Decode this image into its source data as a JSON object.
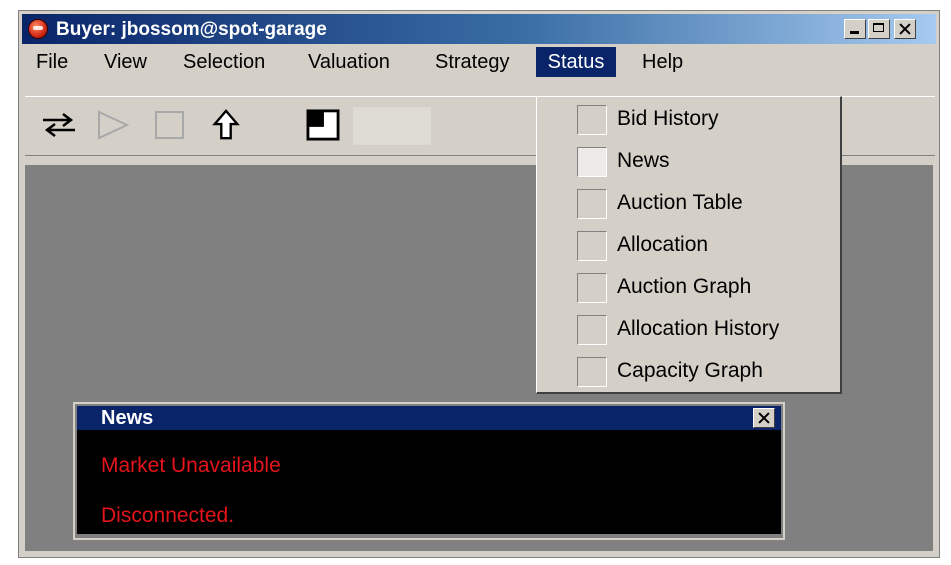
{
  "window": {
    "title": "Buyer: jbossom@spot-garage"
  },
  "menubar": {
    "items": [
      {
        "label": "File"
      },
      {
        "label": "View"
      },
      {
        "label": "Selection"
      },
      {
        "label": "Valuation"
      },
      {
        "label": "Strategy"
      },
      {
        "label": "Status",
        "active": true
      },
      {
        "label": "Help"
      }
    ]
  },
  "toolbar": {
    "icons": [
      "swap-arrows-icon",
      "play-icon",
      "stop-icon",
      "up-arrow-icon",
      "window-layout-icon"
    ]
  },
  "status_menu": {
    "items": [
      {
        "label": "Bid History",
        "checked": false
      },
      {
        "label": "News",
        "checked": true
      },
      {
        "label": "Auction Table",
        "checked": false
      },
      {
        "label": "Allocation",
        "checked": false
      },
      {
        "label": "Auction Graph",
        "checked": false
      },
      {
        "label": "Allocation History",
        "checked": false
      },
      {
        "label": "Capacity Graph",
        "checked": false
      }
    ]
  },
  "news_panel": {
    "title": "News",
    "messages": [
      "Market Unavailable",
      "Disconnected."
    ],
    "message_color": "#e4141b"
  },
  "colors": {
    "titlebar": "#0a246a",
    "chrome": "#d4d0c8",
    "desktop": "#808080"
  }
}
